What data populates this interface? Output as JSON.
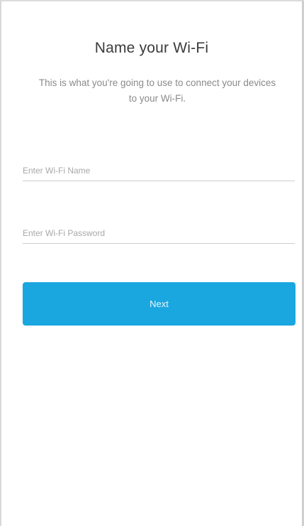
{
  "screen": {
    "title": "Name your Wi-Fi",
    "description": "This is what you're going to use to connect your devices to your Wi-Fi."
  },
  "form": {
    "wifi_name": {
      "value": "",
      "placeholder": "Enter Wi-Fi Name"
    },
    "wifi_password": {
      "value": "",
      "placeholder": "Enter Wi-Fi Password"
    },
    "next_label": "Next"
  },
  "colors": {
    "accent": "#1aa6df",
    "title_text": "#3a3a3a",
    "muted_text": "#8a8a8a"
  }
}
